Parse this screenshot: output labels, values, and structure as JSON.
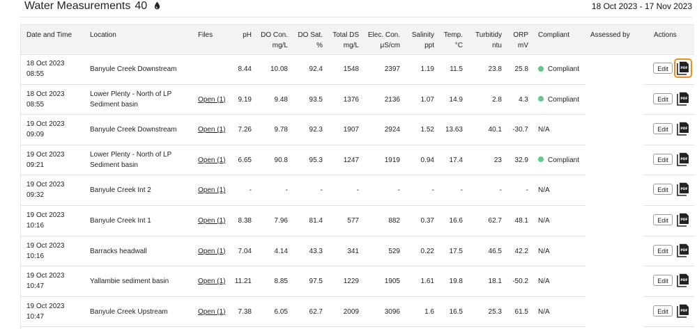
{
  "page": {
    "title": "Water Measurements",
    "count": "40",
    "date_range": "18 Oct 2023 - 17 Nov 2023"
  },
  "table": {
    "headers": {
      "date_time": "Date and Time",
      "location": "Location",
      "files": "Files",
      "ph": "pH",
      "do_con_1": "DO Con.",
      "do_con_2": "mg/L",
      "do_sat_1": "DO Sat.",
      "do_sat_2": "%",
      "tds_1": "Total DS",
      "tds_2": "mg/L",
      "ec_1": "Elec. Con.",
      "ec_2": "μS/cm",
      "sal_1": "Salinity",
      "sal_2": "ppt",
      "temp_1": "Temp.",
      "temp_2": "°C",
      "turb_1": "Turbitidy",
      "turb_2": "ntu",
      "orp_1": "ORP",
      "orp_2": "mV",
      "compliant": "Compliant",
      "assessed_by": "Assessed by",
      "actions": "Actions"
    },
    "edit_label": "Edit",
    "pdf_label": "PDF",
    "rows": [
      {
        "date": "18 Oct 2023",
        "time": "08:55",
        "loc1": "Banyule Creek Downstream",
        "loc2": "",
        "files": "",
        "ph": "8.44",
        "do_con": "10.08",
        "do_sat": "92.4",
        "tds": "1548",
        "ec": "2397",
        "sal": "1.19",
        "temp": "11.5",
        "turb": "23.8",
        "orp": "25.8",
        "compliant": "Compliant",
        "status_color": "#5fc98a"
      },
      {
        "date": "18 Oct 2023",
        "time": "08:55",
        "loc1": "Lower Plenty - North of LP",
        "loc2": "Sediment basin",
        "files": "Open (1)",
        "ph": "9.19",
        "do_con": "9.48",
        "do_sat": "93.5",
        "tds": "1376",
        "ec": "2136",
        "sal": "1.07",
        "temp": "14.9",
        "turb": "2.8",
        "orp": "4.3",
        "compliant": "Compliant",
        "status_color": "#5fc98a"
      },
      {
        "date": "19 Oct 2023",
        "time": "09:09",
        "loc1": "Banyule Creek Downstream",
        "loc2": "",
        "files": "Open (1)",
        "ph": "7.26",
        "do_con": "9.78",
        "do_sat": "92.3",
        "tds": "1907",
        "ec": "2924",
        "sal": "1.52",
        "temp": "13.63",
        "turb": "40.1",
        "orp": "-30.7",
        "compliant": "N/A",
        "status_color": ""
      },
      {
        "date": "19 Oct 2023",
        "time": "09:21",
        "loc1": "Lower Plenty - North of LP",
        "loc2": "Sediment basin",
        "files": "Open (1)",
        "ph": "6.65",
        "do_con": "90.8",
        "do_sat": "95.3",
        "tds": "1247",
        "ec": "1919",
        "sal": "0.94",
        "temp": "17.4",
        "turb": "23",
        "orp": "32.9",
        "compliant": "Compliant",
        "status_color": "#5fc98a"
      },
      {
        "date": "19 Oct 2023",
        "time": "09:32",
        "loc1": "Banyule Creek Int 2",
        "loc2": "",
        "files": "Open (1)",
        "ph": "-",
        "do_con": "-",
        "do_sat": "-",
        "tds": "-",
        "ec": "-",
        "sal": "-",
        "temp": "-",
        "turb": "-",
        "orp": "-",
        "compliant": "N/A",
        "status_color": ""
      },
      {
        "date": "19 Oct 2023",
        "time": "10:16",
        "loc1": "Banyule Creek Int 1",
        "loc2": "",
        "files": "Open (1)",
        "ph": "8.38",
        "do_con": "7.96",
        "do_sat": "81.4",
        "tds": "577",
        "ec": "882",
        "sal": "0.37",
        "temp": "16.6",
        "turb": "62.7",
        "orp": "48.1",
        "compliant": "N/A",
        "status_color": ""
      },
      {
        "date": "19 Oct 2023",
        "time": "10:16",
        "loc1": "Barracks headwall",
        "loc2": "",
        "files": "Open (1)",
        "ph": "7.04",
        "do_con": "4.14",
        "do_sat": "43.3",
        "tds": "341",
        "ec": "529",
        "sal": "0.22",
        "temp": "17.5",
        "turb": "46.5",
        "orp": "42.2",
        "compliant": "N/A",
        "status_color": ""
      },
      {
        "date": "19 Oct 2023",
        "time": "10:47",
        "loc1": "Yallambie sediment basin",
        "loc2": "",
        "files": "Open (1)",
        "ph": "11.21",
        "do_con": "8.85",
        "do_sat": "97.5",
        "tds": "1229",
        "ec": "1905",
        "sal": "1.61",
        "temp": "19.8",
        "turb": "18.1",
        "orp": "-50.2",
        "compliant": "N/A",
        "status_color": ""
      },
      {
        "date": "19 Oct 2023",
        "time": "10:47",
        "loc1": "Banyule Creek Upstream",
        "loc2": "",
        "files": "Open (1)",
        "ph": "7.38",
        "do_con": "6.05",
        "do_sat": "62.7",
        "tds": "2009",
        "ec": "3096",
        "sal": "1.6",
        "temp": "16.5",
        "turb": "25.3",
        "orp": "61.5",
        "compliant": "N/A",
        "status_color": ""
      }
    ]
  },
  "colors": {
    "compliant": "#5fc98a",
    "selection_outline": "#f28c1a",
    "header_bg": "#f3f3f3"
  },
  "icons": {
    "title": "water-drop-icon",
    "pdf": "pdf-file-icon"
  }
}
